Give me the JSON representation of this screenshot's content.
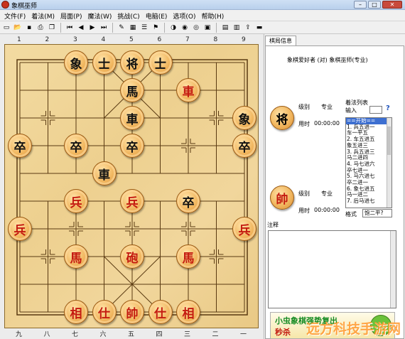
{
  "window": {
    "title": "象棋巫师"
  },
  "menu": [
    "文件(F)",
    "着法(M)",
    "局面(P)",
    "魔法(W)",
    "挑战(C)",
    "电脑(E)",
    "选项(O)",
    "帮助(H)"
  ],
  "toolbar": {
    "icons": [
      "new-icon",
      "open-icon",
      "save-icon",
      "print-icon",
      "copy-icon",
      "sep",
      "first-move-icon",
      "prev-move-icon",
      "next-move-icon",
      "last-move-icon",
      "sep",
      "edit-icon",
      "board-icon",
      "list-icon",
      "tree-icon",
      "sep",
      "color-icon",
      "preview-icon",
      "camera-icon",
      "capture-icon",
      "sep",
      "book-icon",
      "ruler-icon",
      "export-icon",
      "film-icon"
    ]
  },
  "board": {
    "top_coords": [
      "1",
      "2",
      "3",
      "4",
      "5",
      "6",
      "7",
      "8",
      "9"
    ],
    "bottom_coords": [
      "九",
      "八",
      "七",
      "六",
      "五",
      "四",
      "三",
      "二",
      "一"
    ]
  },
  "pieces": [
    {
      "char": "象",
      "color": "black",
      "file": 2,
      "rank": 0
    },
    {
      "char": "士",
      "color": "black",
      "file": 3,
      "rank": 0
    },
    {
      "char": "将",
      "color": "black",
      "file": 4,
      "rank": 0
    },
    {
      "char": "士",
      "color": "black",
      "file": 5,
      "rank": 0
    },
    {
      "char": "馬",
      "color": "black",
      "file": 4,
      "rank": 1
    },
    {
      "char": "車",
      "color": "red",
      "file": 6,
      "rank": 1
    },
    {
      "char": "車",
      "color": "black",
      "file": 4,
      "rank": 2
    },
    {
      "char": "象",
      "color": "black",
      "file": 8,
      "rank": 2
    },
    {
      "char": "卒",
      "color": "black",
      "file": 0,
      "rank": 3
    },
    {
      "char": "卒",
      "color": "black",
      "file": 2,
      "rank": 3
    },
    {
      "char": "卒",
      "color": "black",
      "file": 4,
      "rank": 3
    },
    {
      "char": "卒",
      "color": "black",
      "file": 8,
      "rank": 3
    },
    {
      "char": "車",
      "color": "black",
      "file": 3,
      "rank": 4
    },
    {
      "char": "兵",
      "color": "red",
      "file": 2,
      "rank": 5
    },
    {
      "char": "兵",
      "color": "red",
      "file": 4,
      "rank": 5
    },
    {
      "char": "卒",
      "color": "black",
      "file": 6,
      "rank": 5
    },
    {
      "char": "兵",
      "color": "red",
      "file": 0,
      "rank": 6
    },
    {
      "char": "兵",
      "color": "red",
      "file": 8,
      "rank": 6
    },
    {
      "char": "馬",
      "color": "red",
      "file": 2,
      "rank": 7
    },
    {
      "char": "砲",
      "color": "red",
      "file": 4,
      "rank": 7
    },
    {
      "char": "馬",
      "color": "red",
      "file": 6,
      "rank": 7
    },
    {
      "char": "相",
      "color": "red",
      "file": 2,
      "rank": 9
    },
    {
      "char": "仕",
      "color": "red",
      "file": 3,
      "rank": 9
    },
    {
      "char": "帥",
      "color": "red",
      "file": 4,
      "rank": 9
    },
    {
      "char": "仕",
      "color": "red",
      "file": 5,
      "rank": 9
    },
    {
      "char": "相",
      "color": "red",
      "file": 6,
      "rank": 9
    }
  ],
  "panel": {
    "tab": "棋局信息",
    "matchup": "象棋爱好者  (对)  象棋巫师(专业)",
    "top_player": {
      "piece": "将",
      "level_label": "级别",
      "level": "专业",
      "time_label": "用时",
      "time": "00:00:00"
    },
    "bottom_player": {
      "piece": "帥",
      "level_label": "级别",
      "level": "专业",
      "time_label": "用时",
      "time": "00:00:00"
    },
    "movelist": {
      "title": "着法列表",
      "input_label": "输入",
      "help": "?",
      "rows": [
        "==开始==",
        "1. 兵五进一",
        "   车一平五",
        "2. 车五进五",
        "   象五进三",
        "3. 兵五进三",
        "   马二进四",
        "4. 马七进六",
        "   卒七进一",
        "5. 马六进七",
        "   卒二进一",
        "6. 象七进五",
        "   马一进二",
        "7. 后马进七"
      ],
      "selected_index": 0,
      "format_label": "格式",
      "format_value": "饱二平?"
    },
    "note_label": "注释",
    "ad": {
      "line1": "小虫象棋强势复出",
      "line2": "秒杀"
    }
  },
  "watermark": "远方科技手游网"
}
